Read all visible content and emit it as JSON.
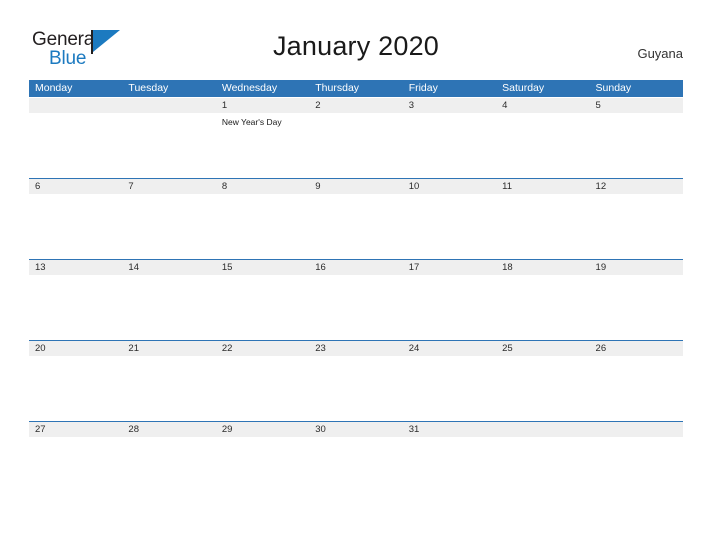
{
  "brand": {
    "name_top": "General",
    "name_bottom": "Blue",
    "color_black": "#231f20",
    "color_blue": "#1c7ac0"
  },
  "header": {
    "title": "January 2020",
    "locale": "Guyana"
  },
  "theme": {
    "header_blue": "#2e74b5",
    "row_band_gray": "#efefef",
    "text_dark": "#2b2b2b"
  },
  "calendar": {
    "weekdays": [
      "Monday",
      "Tuesday",
      "Wednesday",
      "Thursday",
      "Friday",
      "Saturday",
      "Sunday"
    ],
    "weeks": [
      [
        {
          "day": "",
          "event": ""
        },
        {
          "day": "",
          "event": ""
        },
        {
          "day": "1",
          "event": "New Year's Day"
        },
        {
          "day": "2",
          "event": ""
        },
        {
          "day": "3",
          "event": ""
        },
        {
          "day": "4",
          "event": ""
        },
        {
          "day": "5",
          "event": ""
        }
      ],
      [
        {
          "day": "6",
          "event": ""
        },
        {
          "day": "7",
          "event": ""
        },
        {
          "day": "8",
          "event": ""
        },
        {
          "day": "9",
          "event": ""
        },
        {
          "day": "10",
          "event": ""
        },
        {
          "day": "11",
          "event": ""
        },
        {
          "day": "12",
          "event": ""
        }
      ],
      [
        {
          "day": "13",
          "event": ""
        },
        {
          "day": "14",
          "event": ""
        },
        {
          "day": "15",
          "event": ""
        },
        {
          "day": "16",
          "event": ""
        },
        {
          "day": "17",
          "event": ""
        },
        {
          "day": "18",
          "event": ""
        },
        {
          "day": "19",
          "event": ""
        }
      ],
      [
        {
          "day": "20",
          "event": ""
        },
        {
          "day": "21",
          "event": ""
        },
        {
          "day": "22",
          "event": ""
        },
        {
          "day": "23",
          "event": ""
        },
        {
          "day": "24",
          "event": ""
        },
        {
          "day": "25",
          "event": ""
        },
        {
          "day": "26",
          "event": ""
        }
      ],
      [
        {
          "day": "27",
          "event": ""
        },
        {
          "day": "28",
          "event": ""
        },
        {
          "day": "29",
          "event": ""
        },
        {
          "day": "30",
          "event": ""
        },
        {
          "day": "31",
          "event": ""
        },
        {
          "day": "",
          "event": ""
        },
        {
          "day": "",
          "event": ""
        }
      ]
    ]
  }
}
